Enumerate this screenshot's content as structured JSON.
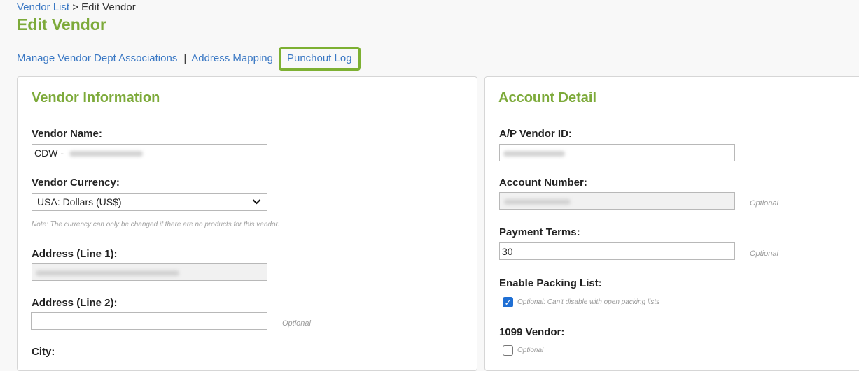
{
  "breadcrumb": {
    "parent": "Vendor List",
    "separator": ">",
    "current": "Edit Vendor"
  },
  "page_title": "Edit Vendor",
  "links": {
    "manage_assoc": "Manage Vendor Dept Associations",
    "separator": "|",
    "address_mapping": "Address Mapping",
    "punchout_log": "Punchout Log"
  },
  "vendor_info": {
    "title": "Vendor Information",
    "vendor_name_label": "Vendor Name:",
    "vendor_name_value": "CDW -",
    "currency_label": "Vendor Currency:",
    "currency_value": "USA: Dollars (US$)",
    "currency_note": "Note: The currency can only be changed if there are no products for this vendor.",
    "address1_label": "Address (Line 1):",
    "address2_label": "Address (Line 2):",
    "address2_optional": "Optional",
    "city_label": "City:"
  },
  "account_detail": {
    "title": "Account Detail",
    "ap_vendor_id_label": "A/P Vendor ID:",
    "account_number_label": "Account Number:",
    "account_number_optional": "Optional",
    "payment_terms_label": "Payment Terms:",
    "payment_terms_value": "30",
    "payment_terms_optional": "Optional",
    "packing_list_label": "Enable Packing List:",
    "packing_list_checked": true,
    "packing_list_note": "Optional: Can't disable with open packing lists",
    "vendor_1099_label": "1099 Vendor:",
    "vendor_1099_checked": false,
    "vendor_1099_optional": "Optional"
  },
  "colors": {
    "accent_green": "#7daa3a",
    "link_blue": "#3a78c4",
    "highlight_border": "#7db032",
    "checkbox_blue": "#1f6fd4"
  }
}
